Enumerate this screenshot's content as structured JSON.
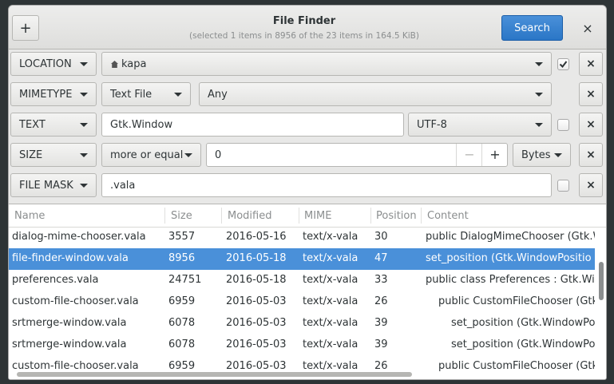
{
  "window": {
    "title": "File Finder",
    "subtitle": "(selected 1 items in 8956 of the 23 items in 164.5 KiB)",
    "add_label": "+",
    "search_label": "Search",
    "close_label": "×"
  },
  "filters": [
    {
      "type": "LOCATION",
      "value": "kapa",
      "checked": true
    },
    {
      "type": "MIMETYPE",
      "category": "Text File",
      "subtype": "Any"
    },
    {
      "type": "TEXT",
      "value": "Gtk.Window",
      "encoding": "UTF-8",
      "checked": false
    },
    {
      "type": "SIZE",
      "operator": "more or equal",
      "value": "0",
      "minus": "−",
      "plus": "+",
      "unit": "Bytes"
    },
    {
      "type": "FILE MASK",
      "value": ".vala",
      "checked": false
    }
  ],
  "remove_label": "×",
  "table": {
    "columns": [
      "Name",
      "Size",
      "Modified",
      "MIME",
      "Position",
      "Content"
    ],
    "rows": [
      {
        "name": "dialog-mime-chooser.vala",
        "size": "3557",
        "modified": "2016-05-16",
        "mime": "text/x-vala",
        "position": "30",
        "content": "public DialogMimeChooser (Gtk.W",
        "indent": 0
      },
      {
        "name": "file-finder-window.vala",
        "size": "8956",
        "modified": "2016-05-18",
        "mime": "text/x-vala",
        "position": "47",
        "content": "set_position (Gtk.WindowPositio",
        "indent": 0,
        "selected": true
      },
      {
        "name": "preferences.vala",
        "size": "24751",
        "modified": "2016-05-18",
        "mime": "text/x-vala",
        "position": "33",
        "content": "public class Preferences : Gtk.Wi",
        "indent": 0
      },
      {
        "name": "custom-file-chooser.vala",
        "size": "6959",
        "modified": "2016-05-03",
        "mime": "text/x-vala",
        "position": "26",
        "content": "public CustomFileChooser (Gtk",
        "indent": 1
      },
      {
        "name": "srtmerge-window.vala",
        "size": "6078",
        "modified": "2016-05-03",
        "mime": "text/x-vala",
        "position": "39",
        "content": "set_position (Gtk.WindowPo",
        "indent": 2
      },
      {
        "name": "srtmerge-window.vala",
        "size": "6078",
        "modified": "2016-05-03",
        "mime": "text/x-vala",
        "position": "39",
        "content": "set_position (Gtk.WindowPo",
        "indent": 2
      },
      {
        "name": "custom-file-chooser.vala",
        "size": "6959",
        "modified": "2016-05-03",
        "mime": "text/x-vala",
        "position": "26",
        "content": "public CustomFileChooser (Gtk",
        "indent": 1
      }
    ]
  },
  "colors": {
    "accent": "#4a90d9",
    "window_bg": "#e8e8e7",
    "desktop": "#2e3436"
  }
}
